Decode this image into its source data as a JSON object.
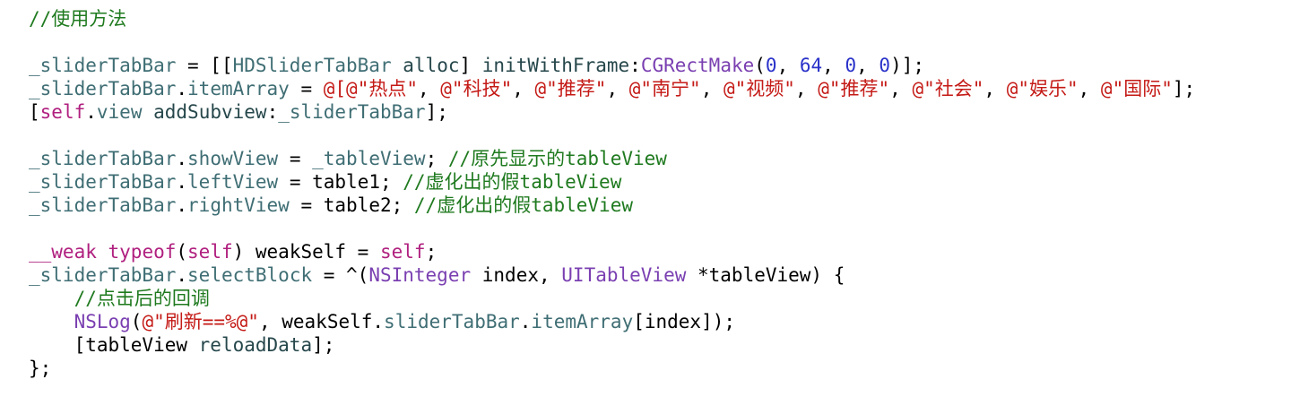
{
  "colors": {
    "comment": "#1f7a1f",
    "instance_variable": "#3f6e74",
    "class_name": "#7a3fb1",
    "keyword": "#b0207f",
    "number": "#2a32c9",
    "string": "#c41a16",
    "plain": "#000000",
    "background": "#ffffff"
  },
  "code": {
    "lines": [
      {
        "tokens": [
          {
            "t": "//使用方法",
            "k": "comment"
          }
        ]
      },
      {
        "tokens": []
      },
      {
        "tokens": [
          {
            "t": "_sliderTabBar",
            "k": "ivar"
          },
          {
            "t": " = [[",
            "k": "plain"
          },
          {
            "t": "HDSliderTabBar",
            "k": "ivar"
          },
          {
            "t": " ",
            "k": "plain"
          },
          {
            "t": "alloc",
            "k": "method"
          },
          {
            "t": "] ",
            "k": "plain"
          },
          {
            "t": "initWithFrame",
            "k": "method"
          },
          {
            "t": ":",
            "k": "plain"
          },
          {
            "t": "CGRectMake",
            "k": "class"
          },
          {
            "t": "(",
            "k": "plain"
          },
          {
            "t": "0",
            "k": "number"
          },
          {
            "t": ", ",
            "k": "plain"
          },
          {
            "t": "64",
            "k": "number"
          },
          {
            "t": ", ",
            "k": "plain"
          },
          {
            "t": "0",
            "k": "number"
          },
          {
            "t": ", ",
            "k": "plain"
          },
          {
            "t": "0",
            "k": "number"
          },
          {
            "t": ")];",
            "k": "plain"
          }
        ]
      },
      {
        "tokens": [
          {
            "t": "_sliderTabBar",
            "k": "ivar"
          },
          {
            "t": ".",
            "k": "plain"
          },
          {
            "t": "itemArray",
            "k": "prop"
          },
          {
            "t": " = ",
            "k": "plain"
          },
          {
            "t": "@[@\"热点\"",
            "k": "string"
          },
          {
            "t": ", ",
            "k": "plain"
          },
          {
            "t": "@\"科技\"",
            "k": "string"
          },
          {
            "t": ", ",
            "k": "plain"
          },
          {
            "t": "@\"推荐\"",
            "k": "string"
          },
          {
            "t": ", ",
            "k": "plain"
          },
          {
            "t": "@\"南宁\"",
            "k": "string"
          },
          {
            "t": ", ",
            "k": "plain"
          },
          {
            "t": "@\"视频\"",
            "k": "string"
          },
          {
            "t": ", ",
            "k": "plain"
          },
          {
            "t": "@\"推荐\"",
            "k": "string"
          },
          {
            "t": ", ",
            "k": "plain"
          },
          {
            "t": "@\"社会\"",
            "k": "string"
          },
          {
            "t": ", ",
            "k": "plain"
          },
          {
            "t": "@\"娱乐\"",
            "k": "string"
          },
          {
            "t": ", ",
            "k": "plain"
          },
          {
            "t": "@\"国际\"",
            "k": "string"
          },
          {
            "t": "];",
            "k": "plain"
          }
        ]
      },
      {
        "tokens": [
          {
            "t": "[",
            "k": "plain"
          },
          {
            "t": "self",
            "k": "keyword"
          },
          {
            "t": ".",
            "k": "plain"
          },
          {
            "t": "view",
            "k": "prop"
          },
          {
            "t": " ",
            "k": "plain"
          },
          {
            "t": "addSubview",
            "k": "method"
          },
          {
            "t": ":",
            "k": "plain"
          },
          {
            "t": "_sliderTabBar",
            "k": "ivar"
          },
          {
            "t": "];",
            "k": "plain"
          }
        ]
      },
      {
        "tokens": []
      },
      {
        "tokens": [
          {
            "t": "_sliderTabBar",
            "k": "ivar"
          },
          {
            "t": ".",
            "k": "plain"
          },
          {
            "t": "showView",
            "k": "prop"
          },
          {
            "t": " = ",
            "k": "plain"
          },
          {
            "t": "_tableView",
            "k": "ivar"
          },
          {
            "t": "; ",
            "k": "plain"
          },
          {
            "t": "//原先显示的tableView",
            "k": "comment"
          }
        ]
      },
      {
        "tokens": [
          {
            "t": "_sliderTabBar",
            "k": "ivar"
          },
          {
            "t": ".",
            "k": "plain"
          },
          {
            "t": "leftView",
            "k": "prop"
          },
          {
            "t": " = table1; ",
            "k": "plain"
          },
          {
            "t": "//虚化出的假tableView",
            "k": "comment"
          }
        ]
      },
      {
        "tokens": [
          {
            "t": "_sliderTabBar",
            "k": "ivar"
          },
          {
            "t": ".",
            "k": "plain"
          },
          {
            "t": "rightView",
            "k": "prop"
          },
          {
            "t": " = table2; ",
            "k": "plain"
          },
          {
            "t": "//虚化出的假tableView",
            "k": "comment"
          }
        ]
      },
      {
        "tokens": []
      },
      {
        "tokens": [
          {
            "t": "__weak",
            "k": "keyword"
          },
          {
            "t": " ",
            "k": "plain"
          },
          {
            "t": "typeof",
            "k": "keyword"
          },
          {
            "t": "(",
            "k": "plain"
          },
          {
            "t": "self",
            "k": "keyword"
          },
          {
            "t": ") weakSelf = ",
            "k": "plain"
          },
          {
            "t": "self",
            "k": "keyword"
          },
          {
            "t": ";",
            "k": "plain"
          }
        ]
      },
      {
        "tokens": [
          {
            "t": "_sliderTabBar",
            "k": "ivar"
          },
          {
            "t": ".",
            "k": "plain"
          },
          {
            "t": "selectBlock",
            "k": "prop"
          },
          {
            "t": " = ^(",
            "k": "plain"
          },
          {
            "t": "NSInteger",
            "k": "class"
          },
          {
            "t": " index, ",
            "k": "plain"
          },
          {
            "t": "UITableView",
            "k": "class"
          },
          {
            "t": " *tableView) {",
            "k": "plain"
          }
        ]
      },
      {
        "tokens": [
          {
            "t": "    ",
            "k": "plain"
          },
          {
            "t": "//点击后的回调",
            "k": "comment"
          }
        ]
      },
      {
        "tokens": [
          {
            "t": "    ",
            "k": "plain"
          },
          {
            "t": "NSLog",
            "k": "class"
          },
          {
            "t": "(",
            "k": "plain"
          },
          {
            "t": "@\"刷新==%@\"",
            "k": "string"
          },
          {
            "t": ", weakSelf.",
            "k": "plain"
          },
          {
            "t": "sliderTabBar",
            "k": "prop"
          },
          {
            "t": ".",
            "k": "plain"
          },
          {
            "t": "itemArray",
            "k": "prop"
          },
          {
            "t": "[index]);",
            "k": "plain"
          }
        ]
      },
      {
        "tokens": [
          {
            "t": "    [tableView ",
            "k": "plain"
          },
          {
            "t": "reloadData",
            "k": "method"
          },
          {
            "t": "];",
            "k": "plain"
          }
        ]
      },
      {
        "tokens": [
          {
            "t": "};",
            "k": "plain"
          }
        ]
      }
    ]
  }
}
